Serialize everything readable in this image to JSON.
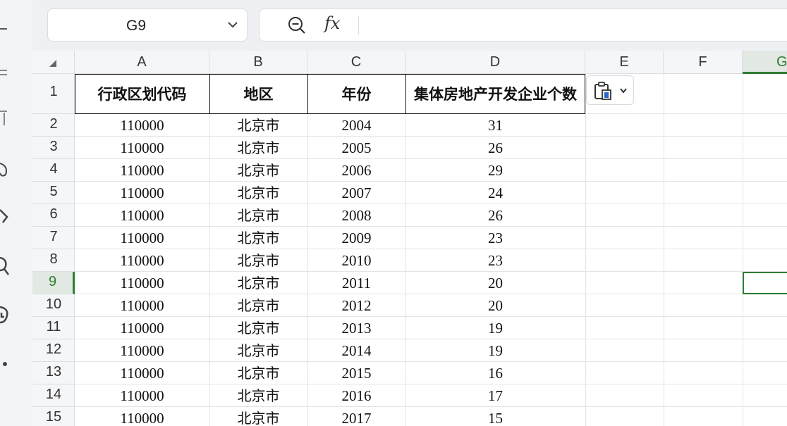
{
  "name_box": {
    "value": "G9"
  },
  "formula_bar": {
    "fx_label": "fx",
    "value": ""
  },
  "columns": [
    "A",
    "B",
    "C",
    "D",
    "E",
    "F",
    "G"
  ],
  "selected_column": "G",
  "rows": [
    "1",
    "2",
    "3",
    "4",
    "5",
    "6",
    "7",
    "8",
    "9",
    "10",
    "11",
    "12",
    "13",
    "14",
    "15"
  ],
  "selected_row": "9",
  "sheet": {
    "headers": [
      "行政区划代码",
      "地区",
      "年份",
      "集体房地产开发企业个数"
    ],
    "data": [
      [
        "110000",
        "北京市",
        "2004",
        "31"
      ],
      [
        "110000",
        "北京市",
        "2005",
        "26"
      ],
      [
        "110000",
        "北京市",
        "2006",
        "29"
      ],
      [
        "110000",
        "北京市",
        "2007",
        "24"
      ],
      [
        "110000",
        "北京市",
        "2008",
        "26"
      ],
      [
        "110000",
        "北京市",
        "2009",
        "23"
      ],
      [
        "110000",
        "北京市",
        "2010",
        "23"
      ],
      [
        "110000",
        "北京市",
        "2011",
        "20"
      ],
      [
        "110000",
        "北京市",
        "2012",
        "20"
      ],
      [
        "110000",
        "北京市",
        "2013",
        "19"
      ],
      [
        "110000",
        "北京市",
        "2014",
        "19"
      ],
      [
        "110000",
        "北京市",
        "2015",
        "16"
      ],
      [
        "110000",
        "北京市",
        "2016",
        "17"
      ],
      [
        "110000",
        "北京市",
        "2017",
        "15"
      ]
    ]
  },
  "icons": {
    "zoom": "zoom-out-icon",
    "dropdown": "chevron-down-icon",
    "paste_options": "clipboard-paste-icon",
    "select_all": "select-all-triangle-icon"
  },
  "colors": {
    "accent": "#2e7d32",
    "header_bg": "#f5f6f8",
    "selected_header_bg": "#e1e9e2"
  }
}
